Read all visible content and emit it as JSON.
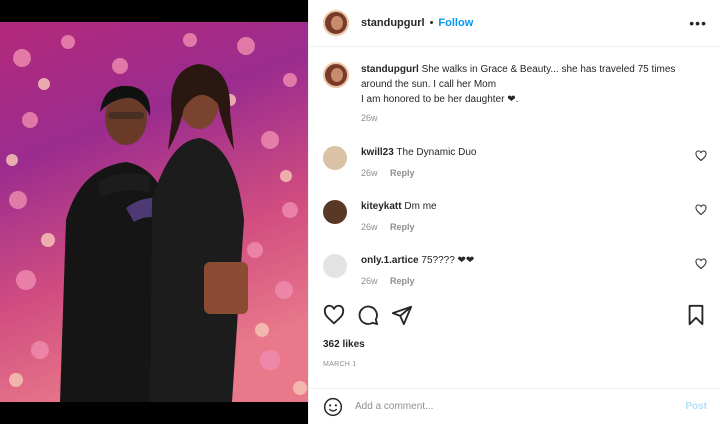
{
  "post": {
    "username": "standupgurl",
    "separator": "•",
    "follow_label": "Follow",
    "more_label": "•••"
  },
  "caption": {
    "username": "standupgurl",
    "text": "She walks in Grace & Beauty... she has traveled 75 times around the sun. I call her Mom",
    "text2": "I am honored to be her daughter ❤︎.",
    "time": "26w"
  },
  "comments": [
    {
      "username": "kwill23",
      "text": "The Dynamic Duo",
      "time": "26w",
      "reply": "Reply"
    },
    {
      "username": "kiteykatt",
      "text": "Dm me",
      "time": "26w",
      "reply": "Reply"
    },
    {
      "username": "only.1.artice",
      "text": "75???? ❤❤",
      "time": "26w",
      "reply": "Reply"
    }
  ],
  "likes": "362 likes",
  "date": "MARCH 1",
  "add_comment": {
    "placeholder": "Add a comment...",
    "post_label": "Post"
  },
  "icons": [
    "heart-icon",
    "comment-icon",
    "share-icon",
    "bookmark-icon",
    "emoji-icon"
  ],
  "colors": {
    "follow": "#0095f6",
    "post_disabled": "#b2dffc",
    "muted": "#8e8e8e"
  }
}
